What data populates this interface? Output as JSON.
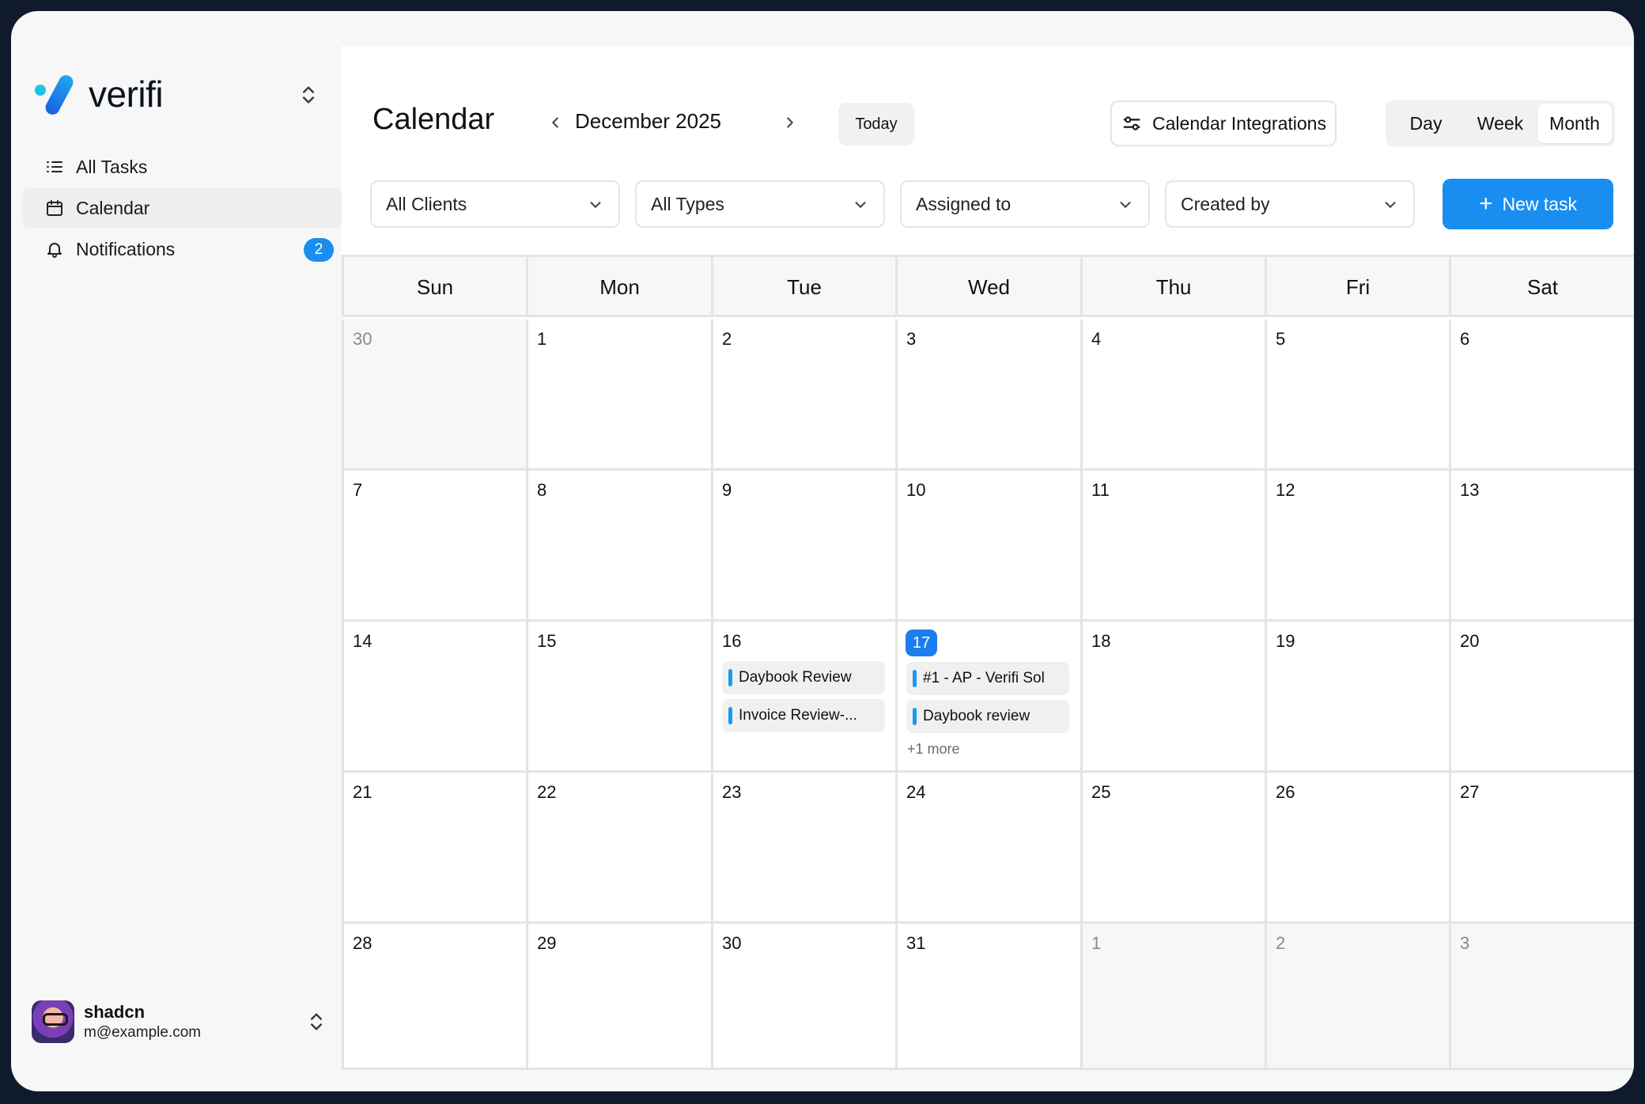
{
  "sidebar": {
    "brand": "verifi",
    "nav": [
      {
        "label": "All Tasks",
        "icon": "list-icon"
      },
      {
        "label": "Calendar",
        "icon": "calendar-icon",
        "active": true
      },
      {
        "label": "Notifications",
        "icon": "bell-icon",
        "badge": "2"
      }
    ],
    "user": {
      "name": "shadcn",
      "email": "m@example.com"
    }
  },
  "header": {
    "title": "Calendar",
    "month": "December 2025",
    "today_label": "Today",
    "integrations_label": "Calendar Integrations",
    "views": [
      "Day",
      "Week",
      "Month"
    ],
    "active_view": "Month"
  },
  "filters": {
    "clients": "All Clients",
    "types": "All Types",
    "assigned": "Assigned to",
    "created": "Created by",
    "new_task": "New task"
  },
  "calendar": {
    "weekdays": [
      "Sun",
      "Mon",
      "Tue",
      "Wed",
      "Thu",
      "Fri",
      "Sat"
    ],
    "weeks": [
      [
        {
          "d": "30",
          "muted": true
        },
        {
          "d": "1"
        },
        {
          "d": "2"
        },
        {
          "d": "3"
        },
        {
          "d": "4"
        },
        {
          "d": "5"
        },
        {
          "d": "6"
        }
      ],
      [
        {
          "d": "7"
        },
        {
          "d": "8"
        },
        {
          "d": "9"
        },
        {
          "d": "10"
        },
        {
          "d": "11"
        },
        {
          "d": "12"
        },
        {
          "d": "13"
        }
      ],
      [
        {
          "d": "14"
        },
        {
          "d": "15"
        },
        {
          "d": "16",
          "events": [
            "Daybook Review",
            "Invoice Review-..."
          ]
        },
        {
          "d": "17",
          "today": true,
          "events": [
            "#1 - AP - Verifi Sol",
            "Daybook review"
          ],
          "more": "+1 more"
        },
        {
          "d": "18"
        },
        {
          "d": "19"
        },
        {
          "d": "20"
        }
      ],
      [
        {
          "d": "21"
        },
        {
          "d": "22"
        },
        {
          "d": "23"
        },
        {
          "d": "24"
        },
        {
          "d": "25"
        },
        {
          "d": "26"
        },
        {
          "d": "27"
        }
      ],
      [
        {
          "d": "28"
        },
        {
          "d": "29"
        },
        {
          "d": "30"
        },
        {
          "d": "31"
        },
        {
          "d": "1",
          "muted": true
        },
        {
          "d": "2",
          "muted": true
        },
        {
          "d": "3",
          "muted": true
        }
      ]
    ]
  },
  "colors": {
    "accent": "#1a8ef0",
    "today": "#1a7ef0",
    "event_bar": "#1a9af0"
  }
}
